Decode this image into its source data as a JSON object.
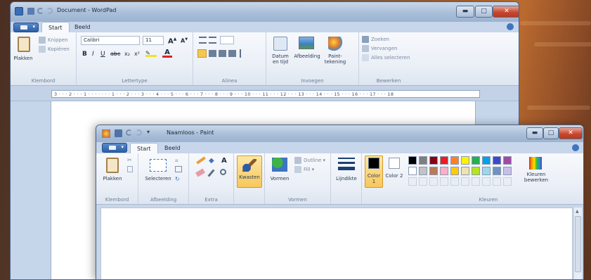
{
  "wordpad": {
    "title": "Document - WordPad",
    "tabs": [
      "Start",
      "Beeld"
    ],
    "clipboard": {
      "paste": "Plakken",
      "cut": "Knippen",
      "copy": "Kopiëren",
      "group": "Klembord"
    },
    "font": {
      "name": "Calibri",
      "size": "11",
      "group": "Lettertype"
    },
    "paragraph": {
      "group": "Alinea"
    },
    "insert": {
      "datetime": "Datum en tijd",
      "image": "Afbeelding",
      "paint": "Paint-tekening",
      "group": "Invoegen"
    },
    "edit": {
      "find": "Zoeken",
      "replace": "Vervangen",
      "select_all": "Alles selecteren",
      "group": "Bewerken"
    },
    "ruler": "3 · · · 2 · · · 1 · · · · · · · 1 · · · 2 · · · 3 · · · 4 · · · 5 · · · 6 · · · 7 · · · 8 · · · 9 · · · 10 · · · 11 · · · 12 · · · 13 · · · 14 · · · 15 · · · 16 · · · 17 · · · 18"
  },
  "paint": {
    "title": "Naamloos - Paint",
    "tabs": [
      "Start",
      "Beeld"
    ],
    "clipboard": {
      "paste": "Plakken",
      "group": "Klembord"
    },
    "image": {
      "select": "Selecteren",
      "group": "Afbeelding"
    },
    "tools": {
      "group": "Extra"
    },
    "brushes": {
      "label": "Kwasten"
    },
    "shapes": {
      "label": "Vormen",
      "outline": "Outline",
      "fill": "Fill",
      "group": "Vormen"
    },
    "size": {
      "label": "Lijndikte"
    },
    "color1": {
      "label": "Color 1",
      "value": "#000000"
    },
    "color2": {
      "label": "Color 2",
      "value": "#ffffff"
    },
    "colors": {
      "group": "Kleuren",
      "edit": "Kleuren bewerken",
      "palette": [
        "#000000",
        "#7f7f7f",
        "#880015",
        "#ed1c24",
        "#ff7f27",
        "#fff200",
        "#22b14c",
        "#00a2e8",
        "#3f48cc",
        "#a349a4",
        "#ffffff",
        "#c3c3c3",
        "#b97a57",
        "#ffaec9",
        "#ffc90e",
        "#efe4b0",
        "#b5e61d",
        "#99d9ea",
        "#7092be",
        "#c8bfe7"
      ]
    }
  }
}
